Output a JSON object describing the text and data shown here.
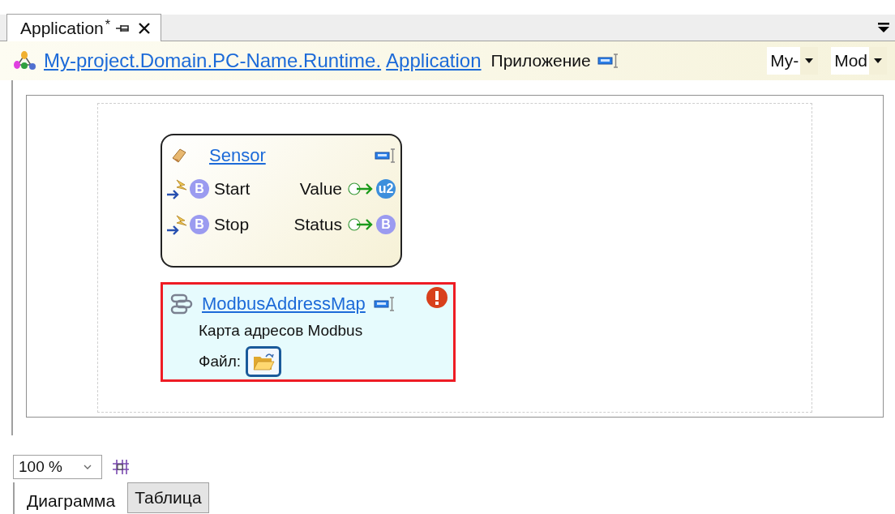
{
  "document_tab": {
    "title": "Application",
    "modified_mark": "*",
    "selected": true
  },
  "header": {
    "path": "My-project.Domain.PC-Name.Runtime.",
    "name": "Application",
    "type_label": "Приложение",
    "dropdowns": [
      "My-",
      "Mod"
    ]
  },
  "nodes": [
    {
      "kind": "function_block",
      "title": "Sensor",
      "inputs": [
        {
          "name": "Start",
          "type": "B",
          "color": "#9b9bf0"
        },
        {
          "name": "Stop",
          "type": "B",
          "color": "#9b9bf0"
        }
      ],
      "outputs": [
        {
          "name": "Value",
          "type": "u2",
          "color": "#3d8fdc"
        },
        {
          "name": "Status",
          "type": "B",
          "color": "#9b9bf0"
        }
      ]
    },
    {
      "kind": "resource",
      "title": "ModbusAddressMap",
      "description": "Карта адресов Modbus",
      "file_label": "Файл:",
      "error": true
    }
  ],
  "zoom": "100 %",
  "view_tabs": [
    {
      "label": "Диаграмма",
      "selected": true
    },
    {
      "label": "Таблица",
      "selected": false
    }
  ]
}
